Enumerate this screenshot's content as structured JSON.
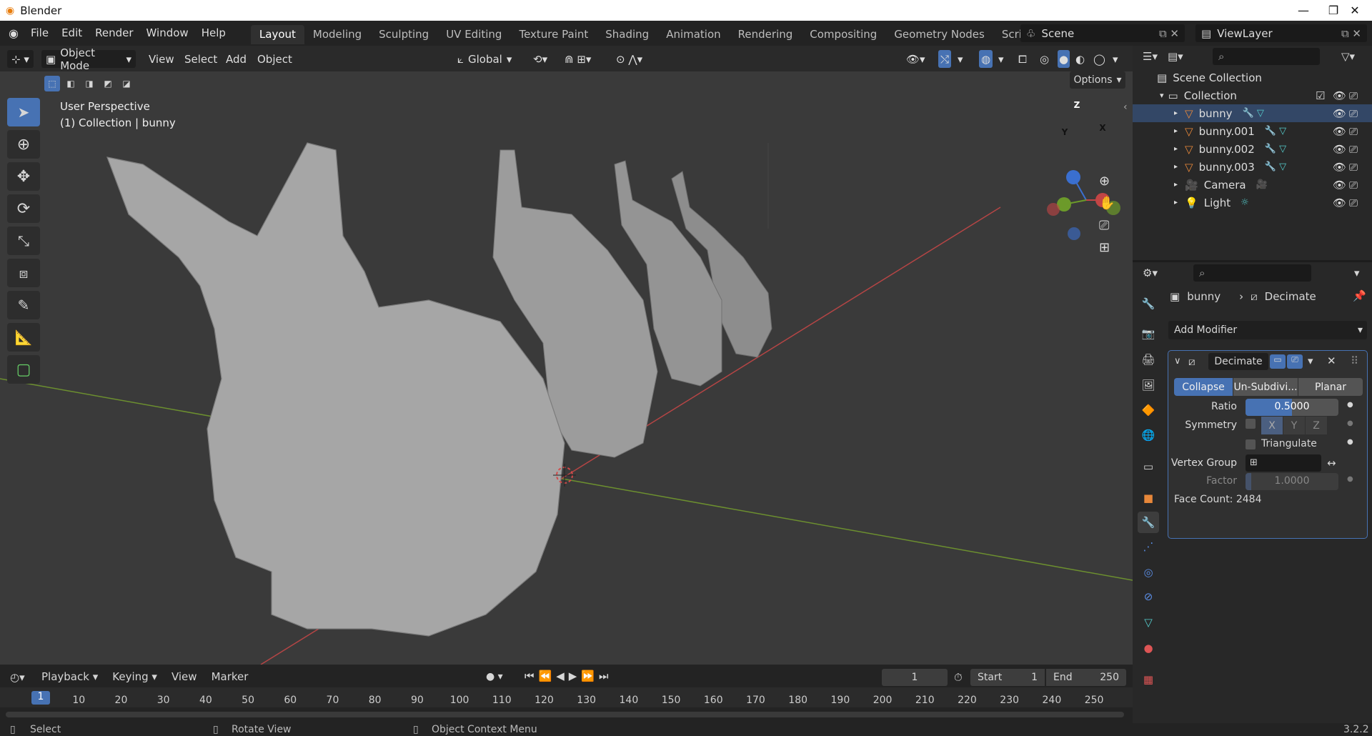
{
  "window": {
    "title": "Blender",
    "version": "3.2.2"
  },
  "menu": {
    "items": [
      "File",
      "Edit",
      "Render",
      "Window",
      "Help"
    ]
  },
  "workspaces": {
    "tabs": [
      "Layout",
      "Modeling",
      "Sculpting",
      "UV Editing",
      "Texture Paint",
      "Shading",
      "Animation",
      "Rendering",
      "Compositing",
      "Geometry Nodes",
      "Scripting"
    ],
    "active": "Layout",
    "add_label": "+"
  },
  "scene": {
    "name": "Scene",
    "view_layer": "ViewLayer"
  },
  "viewport_header": {
    "mode": "Object Mode",
    "menus": [
      "View",
      "Select",
      "Add",
      "Object"
    ],
    "transform_orientation": "Global",
    "options_label": "Options"
  },
  "viewport": {
    "perspective": "User Perspective",
    "context": "(1) Collection | bunny",
    "gizmo": {
      "z": "Z",
      "y": "Y",
      "x": "X"
    }
  },
  "outliner": {
    "root": "Scene Collection",
    "collection": "Collection",
    "objects": [
      {
        "name": "bunny",
        "icon": "mesh-icon"
      },
      {
        "name": "bunny.001",
        "icon": "mesh-icon"
      },
      {
        "name": "bunny.002",
        "icon": "mesh-icon"
      },
      {
        "name": "bunny.003",
        "icon": "mesh-icon"
      },
      {
        "name": "Camera",
        "icon": "camera-icon"
      },
      {
        "name": "Light",
        "icon": "light-icon"
      }
    ]
  },
  "properties": {
    "object": "bunny",
    "modifier_breadcrumb": "Decimate",
    "add_modifier": "Add Modifier",
    "modifier": {
      "name": "Decimate",
      "modes": [
        "Collapse",
        "Un-Subdivi...",
        "Planar"
      ],
      "active_mode": "Collapse",
      "ratio_label": "Ratio",
      "ratio": "0.5000",
      "ratio_fraction": 0.5,
      "symmetry_label": "Symmetry",
      "axes": [
        "X",
        "Y",
        "Z"
      ],
      "triangulate_label": "Triangulate",
      "vertex_group_label": "Vertex Group",
      "factor_label": "Factor",
      "factor": "1.0000",
      "face_count": "Face Count: 2484"
    }
  },
  "timeline": {
    "menus": [
      "Playback",
      "Keying",
      "View",
      "Marker"
    ],
    "current_frame": "1",
    "start_label": "Start",
    "start": "1",
    "end_label": "End",
    "end": "250",
    "ticks": [
      "10",
      "20",
      "30",
      "40",
      "50",
      "60",
      "70",
      "80",
      "90",
      "100",
      "110",
      "120",
      "130",
      "140",
      "150",
      "160",
      "170",
      "180",
      "190",
      "200",
      "210",
      "220",
      "230",
      "240",
      "250"
    ],
    "frame_marker": "1"
  },
  "statusbar": {
    "select": "Select",
    "rotate": "Rotate View",
    "context": "Object Context Menu"
  },
  "colors": {
    "accent": "#4772b3",
    "header": "#232323",
    "viewport": "#3a3a3a",
    "x_axis": "#b54545",
    "y_axis": "#6c8f2f",
    "mesh_icon": "#e8883a"
  }
}
